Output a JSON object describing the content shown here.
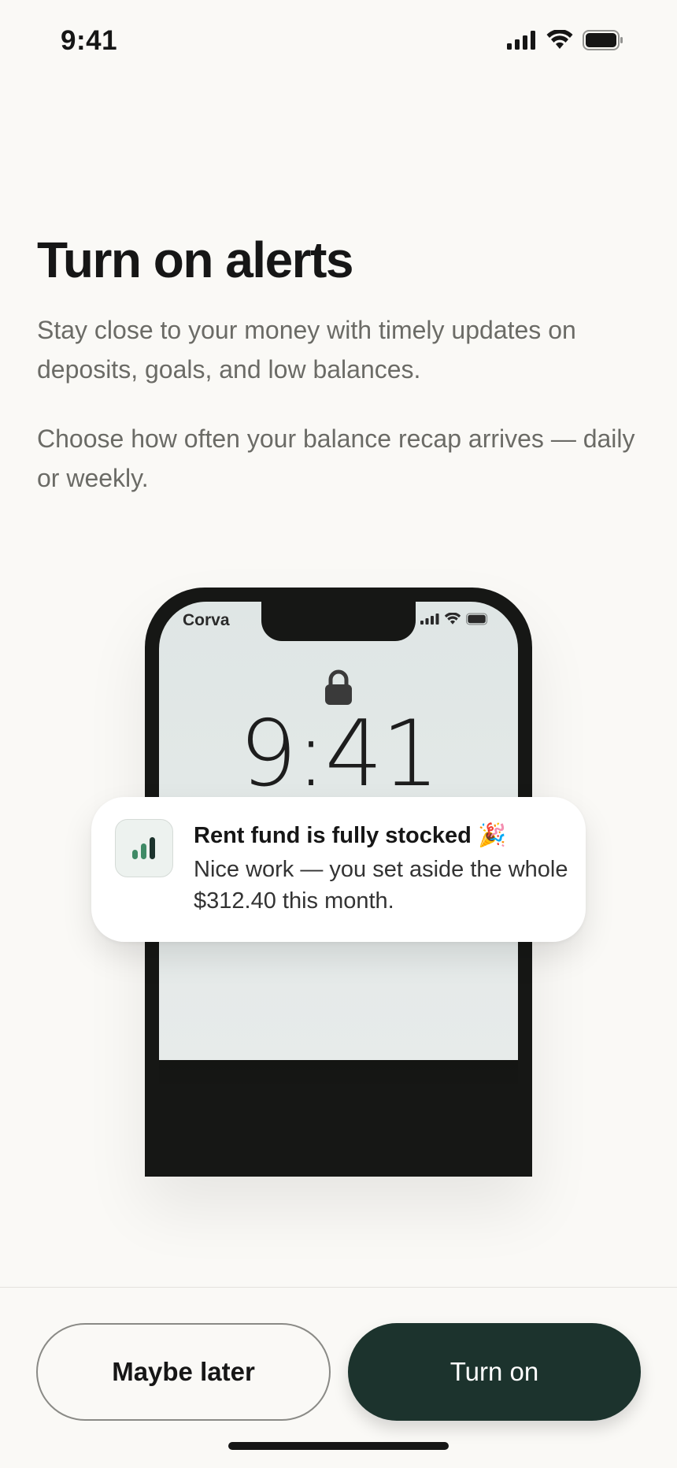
{
  "status_bar": {
    "time": "9:41",
    "icons": [
      "signal-icon",
      "wifi-icon",
      "battery-icon"
    ]
  },
  "header": {
    "title": "Turn on alerts",
    "paragraph1": "Stay close to your money with timely updates on deposits, goals, and low balances.",
    "paragraph2": "Choose how often your balance recap arrives — daily or weekly."
  },
  "phone_mock": {
    "carrier": "Corva",
    "lock_time": "9:41",
    "notification": {
      "title": "Rent fund is fully stocked",
      "emoji": "🎉",
      "body": "Nice work — you set aside the whole $312.40 this month.",
      "icon": "bar-chart-icon"
    }
  },
  "actions": {
    "secondary_label": "Maybe later",
    "primary_label": "Turn on"
  },
  "colors": {
    "background": "#faf9f6",
    "primary_button": "#1c332d",
    "icon_green": "#3f8a66"
  }
}
